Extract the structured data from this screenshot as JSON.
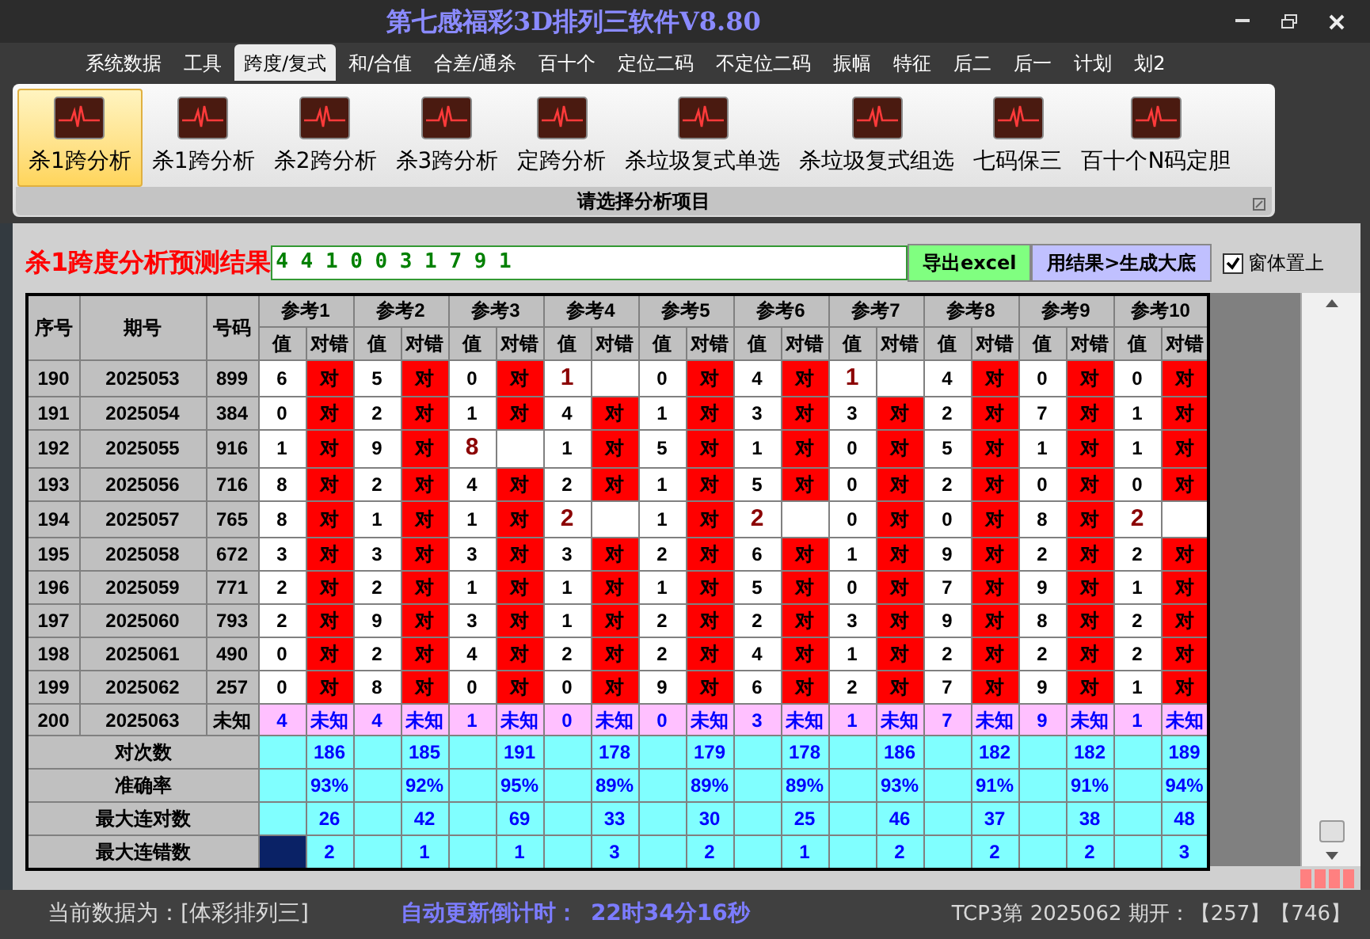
{
  "window": {
    "title": "第七感福彩3D排列三软件V8.80"
  },
  "menu": [
    {
      "label": "系统数据",
      "selected": false
    },
    {
      "label": "工具",
      "selected": false
    },
    {
      "label": "跨度/复式",
      "selected": true
    },
    {
      "label": "和/合值",
      "selected": false
    },
    {
      "label": "合差/通杀",
      "selected": false
    },
    {
      "label": "百十个",
      "selected": false
    },
    {
      "label": "定位二码",
      "selected": false
    },
    {
      "label": "不定位二码",
      "selected": false
    },
    {
      "label": "振幅",
      "selected": false
    },
    {
      "label": "特征",
      "selected": false
    },
    {
      "label": "后二",
      "selected": false
    },
    {
      "label": "后一",
      "selected": false
    },
    {
      "label": "计划",
      "selected": false
    },
    {
      "label": "划2",
      "selected": false
    }
  ],
  "ribbon": {
    "items": [
      {
        "label": "杀1跨分析",
        "selected": true
      },
      {
        "label": "杀1跨分析",
        "selected": false
      },
      {
        "label": "杀2跨分析",
        "selected": false
      },
      {
        "label": "杀3跨分析",
        "selected": false
      },
      {
        "label": "定跨分析",
        "selected": false
      },
      {
        "label": "杀垃圾复式单选",
        "selected": false
      },
      {
        "label": "杀垃圾复式组选",
        "selected": false
      },
      {
        "label": "七码保三",
        "selected": false
      },
      {
        "label": "百十个N码定胆",
        "selected": false
      }
    ],
    "caption": "请选择分析项目"
  },
  "result": {
    "label": "杀1跨度分析预测结果",
    "value": "4 4 1 0 0 3 1 7 9 1"
  },
  "buttons": [
    "导出excel",
    "用结果>生成大底"
  ],
  "checkbox": {
    "label": "窗体置上",
    "checked": true
  },
  "table": {
    "columns": [
      "序号",
      "期号",
      "号码"
    ],
    "groups": [
      {
        "label": "参考1",
        "sub_headers": [
          "值",
          "对错"
        ]
      },
      {
        "label": "参考2",
        "sub_headers": [
          "值",
          "对错"
        ]
      },
      {
        "label": "参考3",
        "sub_headers": [
          "值",
          "对错"
        ]
      },
      {
        "label": "参考4",
        "sub_headers": [
          "值",
          "对错"
        ]
      },
      {
        "label": "参考5",
        "sub_headers": [
          "值",
          "对错"
        ]
      },
      {
        "label": "参考6",
        "sub_headers": [
          "值",
          "对错"
        ]
      },
      {
        "label": "参考7",
        "sub_headers": [
          "值",
          "对错"
        ]
      },
      {
        "label": "参考8",
        "sub_headers": [
          "值",
          "对错"
        ]
      },
      {
        "label": "参考9",
        "sub_headers": [
          "值",
          "对错"
        ]
      },
      {
        "label": "参考10",
        "sub_headers": [
          "值",
          "对错"
        ]
      }
    ],
    "rows": [
      {
        "kind": "history",
        "index": "190",
        "issue": "2025053",
        "number": "899",
        "cells": [
          {
            "value": "6",
            "result": "对",
            "hit": true
          },
          {
            "value": "5",
            "result": "对",
            "hit": true
          },
          {
            "value": "0",
            "result": "对",
            "hit": true
          },
          {
            "value": "1",
            "hit": false
          },
          {
            "value": "0",
            "result": "对",
            "hit": true
          },
          {
            "value": "4",
            "result": "对",
            "hit": true
          },
          {
            "value": "1",
            "hit": false
          },
          {
            "value": "4",
            "result": "对",
            "hit": true
          },
          {
            "value": "0",
            "result": "对",
            "hit": true
          },
          {
            "value": "0",
            "result": "对",
            "hit": true
          }
        ]
      },
      {
        "kind": "history",
        "index": "191",
        "issue": "2025054",
        "number": "384",
        "cells": [
          {
            "value": "0",
            "result": "对",
            "hit": true
          },
          {
            "value": "2",
            "result": "对",
            "hit": true
          },
          {
            "value": "1",
            "result": "对",
            "hit": true
          },
          {
            "value": "4",
            "result": "对",
            "hit": true
          },
          {
            "value": "1",
            "result": "对",
            "hit": true
          },
          {
            "value": "3",
            "result": "对",
            "hit": true
          },
          {
            "value": "3",
            "result": "对",
            "hit": true
          },
          {
            "value": "2",
            "result": "对",
            "hit": true
          },
          {
            "value": "7",
            "result": "对",
            "hit": true
          },
          {
            "value": "1",
            "result": "对",
            "hit": true
          }
        ]
      },
      {
        "kind": "history",
        "index": "192",
        "issue": "2025055",
        "number": "916",
        "cells": [
          {
            "value": "1",
            "result": "对",
            "hit": true
          },
          {
            "value": "9",
            "result": "对",
            "hit": true
          },
          {
            "value": "8",
            "hit": false
          },
          {
            "value": "1",
            "result": "对",
            "hit": true
          },
          {
            "value": "5",
            "result": "对",
            "hit": true
          },
          {
            "value": "1",
            "result": "对",
            "hit": true
          },
          {
            "value": "0",
            "result": "对",
            "hit": true
          },
          {
            "value": "5",
            "result": "对",
            "hit": true
          },
          {
            "value": "1",
            "result": "对",
            "hit": true
          },
          {
            "value": "1",
            "result": "对",
            "hit": true
          }
        ]
      },
      {
        "kind": "history",
        "index": "193",
        "issue": "2025056",
        "number": "716",
        "cells": [
          {
            "value": "8",
            "result": "对",
            "hit": true
          },
          {
            "value": "2",
            "result": "对",
            "hit": true
          },
          {
            "value": "4",
            "result": "对",
            "hit": true
          },
          {
            "value": "2",
            "result": "对",
            "hit": true
          },
          {
            "value": "1",
            "result": "对",
            "hit": true
          },
          {
            "value": "5",
            "result": "对",
            "hit": true
          },
          {
            "value": "0",
            "result": "对",
            "hit": true
          },
          {
            "value": "2",
            "result": "对",
            "hit": true
          },
          {
            "value": "0",
            "result": "对",
            "hit": true
          },
          {
            "value": "0",
            "result": "对",
            "hit": true
          }
        ]
      },
      {
        "kind": "history",
        "index": "194",
        "issue": "2025057",
        "number": "765",
        "cells": [
          {
            "value": "8",
            "result": "对",
            "hit": true
          },
          {
            "value": "1",
            "result": "对",
            "hit": true
          },
          {
            "value": "1",
            "result": "对",
            "hit": true
          },
          {
            "value": "2",
            "hit": false
          },
          {
            "value": "1",
            "result": "对",
            "hit": true
          },
          {
            "value": "2",
            "hit": false
          },
          {
            "value": "0",
            "result": "对",
            "hit": true
          },
          {
            "value": "0",
            "result": "对",
            "hit": true
          },
          {
            "value": "8",
            "result": "对",
            "hit": true
          },
          {
            "value": "2",
            "hit": false
          }
        ]
      },
      {
        "kind": "history",
        "index": "195",
        "issue": "2025058",
        "number": "672",
        "cells": [
          {
            "value": "3",
            "result": "对",
            "hit": true
          },
          {
            "value": "3",
            "result": "对",
            "hit": true
          },
          {
            "value": "3",
            "result": "对",
            "hit": true
          },
          {
            "value": "3",
            "result": "对",
            "hit": true
          },
          {
            "value": "2",
            "result": "对",
            "hit": true
          },
          {
            "value": "6",
            "result": "对",
            "hit": true
          },
          {
            "value": "1",
            "result": "对",
            "hit": true
          },
          {
            "value": "9",
            "result": "对",
            "hit": true
          },
          {
            "value": "2",
            "result": "对",
            "hit": true
          },
          {
            "value": "2",
            "result": "对",
            "hit": true
          }
        ]
      },
      {
        "kind": "history",
        "index": "196",
        "issue": "2025059",
        "number": "771",
        "cells": [
          {
            "value": "2",
            "result": "对",
            "hit": true
          },
          {
            "value": "2",
            "result": "对",
            "hit": true
          },
          {
            "value": "1",
            "result": "对",
            "hit": true
          },
          {
            "value": "1",
            "result": "对",
            "hit": true
          },
          {
            "value": "1",
            "result": "对",
            "hit": true
          },
          {
            "value": "5",
            "result": "对",
            "hit": true
          },
          {
            "value": "0",
            "result": "对",
            "hit": true
          },
          {
            "value": "7",
            "result": "对",
            "hit": true
          },
          {
            "value": "9",
            "result": "对",
            "hit": true
          },
          {
            "value": "1",
            "result": "对",
            "hit": true
          }
        ]
      },
      {
        "kind": "history",
        "index": "197",
        "issue": "2025060",
        "number": "793",
        "cells": [
          {
            "value": "2",
            "result": "对",
            "hit": true
          },
          {
            "value": "9",
            "result": "对",
            "hit": true
          },
          {
            "value": "3",
            "result": "对",
            "hit": true
          },
          {
            "value": "1",
            "result": "对",
            "hit": true
          },
          {
            "value": "2",
            "result": "对",
            "hit": true
          },
          {
            "value": "2",
            "result": "对",
            "hit": true
          },
          {
            "value": "3",
            "result": "对",
            "hit": true
          },
          {
            "value": "9",
            "result": "对",
            "hit": true
          },
          {
            "value": "8",
            "result": "对",
            "hit": true
          },
          {
            "value": "2",
            "result": "对",
            "hit": true
          }
        ]
      },
      {
        "kind": "history",
        "index": "198",
        "issue": "2025061",
        "number": "490",
        "cells": [
          {
            "value": "0",
            "result": "对",
            "hit": true
          },
          {
            "value": "2",
            "result": "对",
            "hit": true
          },
          {
            "value": "4",
            "result": "对",
            "hit": true
          },
          {
            "value": "2",
            "result": "对",
            "hit": true
          },
          {
            "value": "2",
            "result": "对",
            "hit": true
          },
          {
            "value": "4",
            "result": "对",
            "hit": true
          },
          {
            "value": "1",
            "result": "对",
            "hit": true
          },
          {
            "value": "2",
            "result": "对",
            "hit": true
          },
          {
            "value": "2",
            "result": "对",
            "hit": true
          },
          {
            "value": "2",
            "result": "对",
            "hit": true
          }
        ]
      },
      {
        "kind": "history",
        "index": "199",
        "issue": "2025062",
        "number": "257",
        "cells": [
          {
            "value": "0",
            "result": "对",
            "hit": true
          },
          {
            "value": "8",
            "result": "对",
            "hit": true
          },
          {
            "value": "0",
            "result": "对",
            "hit": true
          },
          {
            "value": "0",
            "result": "对",
            "hit": true
          },
          {
            "value": "9",
            "result": "对",
            "hit": true
          },
          {
            "value": "6",
            "result": "对",
            "hit": true
          },
          {
            "value": "2",
            "result": "对",
            "hit": true
          },
          {
            "value": "7",
            "result": "对",
            "hit": true
          },
          {
            "value": "9",
            "result": "对",
            "hit": true
          },
          {
            "value": "1",
            "result": "对",
            "hit": true
          }
        ]
      },
      {
        "kind": "pending",
        "index": "200",
        "issue": "2025063",
        "number": "未知",
        "cells": [
          {
            "value": "4",
            "result": "未知"
          },
          {
            "value": "4",
            "result": "未知"
          },
          {
            "value": "1",
            "result": "未知"
          },
          {
            "value": "0",
            "result": "未知"
          },
          {
            "value": "0",
            "result": "未知"
          },
          {
            "value": "3",
            "result": "未知"
          },
          {
            "value": "1",
            "result": "未知"
          },
          {
            "value": "7",
            "result": "未知"
          },
          {
            "value": "9",
            "result": "未知"
          },
          {
            "value": "1",
            "result": "未知"
          }
        ]
      }
    ],
    "summary": [
      {
        "label": "对次数",
        "values": [
          "186",
          "185",
          "191",
          "178",
          "179",
          "178",
          "186",
          "182",
          "182",
          "189"
        ],
        "blank_selected": false
      },
      {
        "label": "准确率",
        "values": [
          "93%",
          "92%",
          "95%",
          "89%",
          "89%",
          "89%",
          "93%",
          "91%",
          "91%",
          "94%"
        ],
        "blank_selected": false
      },
      {
        "label": "最大连对数",
        "values": [
          "26",
          "42",
          "69",
          "33",
          "30",
          "25",
          "46",
          "37",
          "38",
          "48"
        ],
        "blank_selected": false
      },
      {
        "label": "最大连错数",
        "values": [
          "2",
          "1",
          "1",
          "3",
          "2",
          "1",
          "2",
          "2",
          "2",
          "3"
        ],
        "blank_selected": true
      }
    ]
  },
  "status_bar": {
    "data_source": "当前数据为：[体彩排列三]",
    "countdown_label": "自动更新倒计时：",
    "countdown": "22时34分16秒",
    "draw_info": "TCP3第 2025062 期开：【257】【746】"
  }
}
